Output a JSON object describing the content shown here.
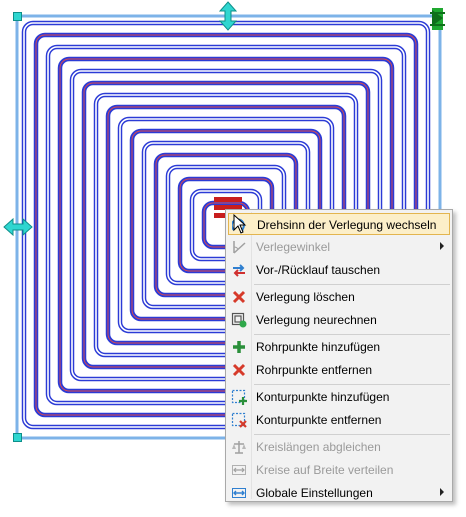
{
  "colors": {
    "pipe_outer": "#2b3bd6",
    "pipe_inner": "#9aa6f2",
    "pipe_return": "#e24b4b",
    "selection": "#7db3e8",
    "handle": "#2fd6d0",
    "menu_bg": "#f2f2f2",
    "menu_highlight": "#fcefc9",
    "disabled_text": "#9a9a9a"
  },
  "context_menu": {
    "items": [
      {
        "label": "Drehsinn der Verlegung wechseln",
        "icon": "rotation-direction-icon",
        "highlighted": true,
        "disabled": false,
        "submenu": false
      },
      {
        "label": "Verlegewinkel",
        "icon": "angle-icon",
        "highlighted": false,
        "disabled": true,
        "submenu": true
      },
      {
        "label": "Vor-/Rücklauf tauschen",
        "icon": "swap-flow-icon",
        "highlighted": false,
        "disabled": false,
        "submenu": false
      },
      {
        "label": "Verlegung löschen",
        "icon": "delete-icon",
        "highlighted": false,
        "disabled": false,
        "submenu": false
      },
      {
        "label": "Verlegung neurechnen",
        "icon": "recalculate-icon",
        "highlighted": false,
        "disabled": false,
        "submenu": false
      },
      {
        "label": "Rohrpunkte hinzufügen",
        "icon": "add-point-icon",
        "highlighted": false,
        "disabled": false,
        "submenu": false
      },
      {
        "label": "Rohrpunkte entfernen",
        "icon": "remove-point-icon",
        "highlighted": false,
        "disabled": false,
        "submenu": false
      },
      {
        "label": "Konturpunkte hinzufügen",
        "icon": "add-contour-point-icon",
        "highlighted": false,
        "disabled": false,
        "submenu": false
      },
      {
        "label": "Konturpunkte entfernen",
        "icon": "remove-contour-point-icon",
        "highlighted": false,
        "disabled": false,
        "submenu": false
      },
      {
        "label": "Kreislängen abgleichen",
        "icon": "balance-icon",
        "highlighted": false,
        "disabled": true,
        "submenu": false
      },
      {
        "label": "Kreise auf Breite verteilen",
        "icon": "distribute-width-icon",
        "highlighted": false,
        "disabled": true,
        "submenu": false
      },
      {
        "label": "Globale Einstellungen",
        "icon": "global-settings-icon",
        "highlighted": false,
        "disabled": false,
        "submenu": true
      }
    ]
  }
}
